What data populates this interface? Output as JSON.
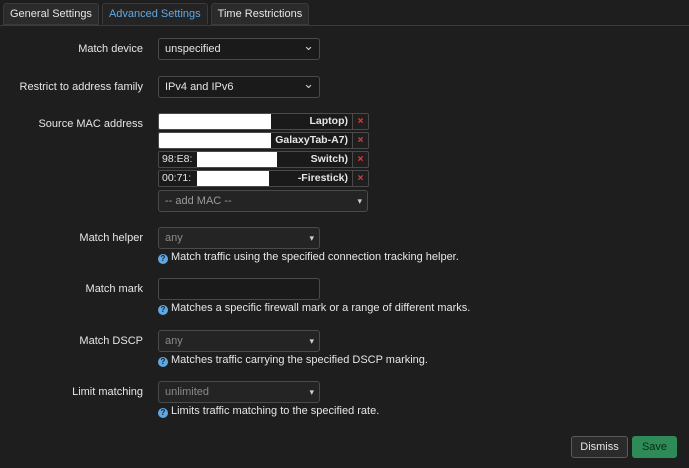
{
  "tabs": [
    {
      "label": "General Settings"
    },
    {
      "label": "Advanced Settings"
    },
    {
      "label": "Time Restrictions"
    }
  ],
  "fields": {
    "match_device": {
      "label": "Match device",
      "value": "unspecified"
    },
    "address_family": {
      "label": "Restrict to address family",
      "value": "IPv4 and IPv6"
    },
    "source_mac": {
      "label": "Source MAC address",
      "entries": [
        {
          "prefix": "",
          "suffix": "Laptop)"
        },
        {
          "prefix": "",
          "suffix": "GalaxyTab-A7)"
        },
        {
          "prefix": "98:E8:",
          "suffix": "Switch)"
        },
        {
          "prefix": "00:71:",
          "suffix": "-Firestick)"
        }
      ],
      "add_placeholder": "-- add MAC --",
      "delete_glyph": "×"
    },
    "match_helper": {
      "label": "Match helper",
      "value": "any",
      "hint": "Match traffic using the specified connection tracking helper."
    },
    "match_mark": {
      "label": "Match mark",
      "value": "",
      "hint": "Matches a specific firewall mark or a range of different marks."
    },
    "match_dscp": {
      "label": "Match DSCP",
      "value": "any",
      "hint": "Matches traffic carrying the specified DSCP marking."
    },
    "limit_matching": {
      "label": "Limit matching",
      "value": "unlimited",
      "hint": "Limits traffic matching to the specified rate."
    }
  },
  "buttons": {
    "dismiss": "Dismiss",
    "save": "Save"
  },
  "icons": {
    "help": "?",
    "chevron": "⌄",
    "caret": "▾"
  },
  "colors": {
    "accent": "#5fa8e6",
    "save": "#2e8b57",
    "danger": "#e04040"
  }
}
